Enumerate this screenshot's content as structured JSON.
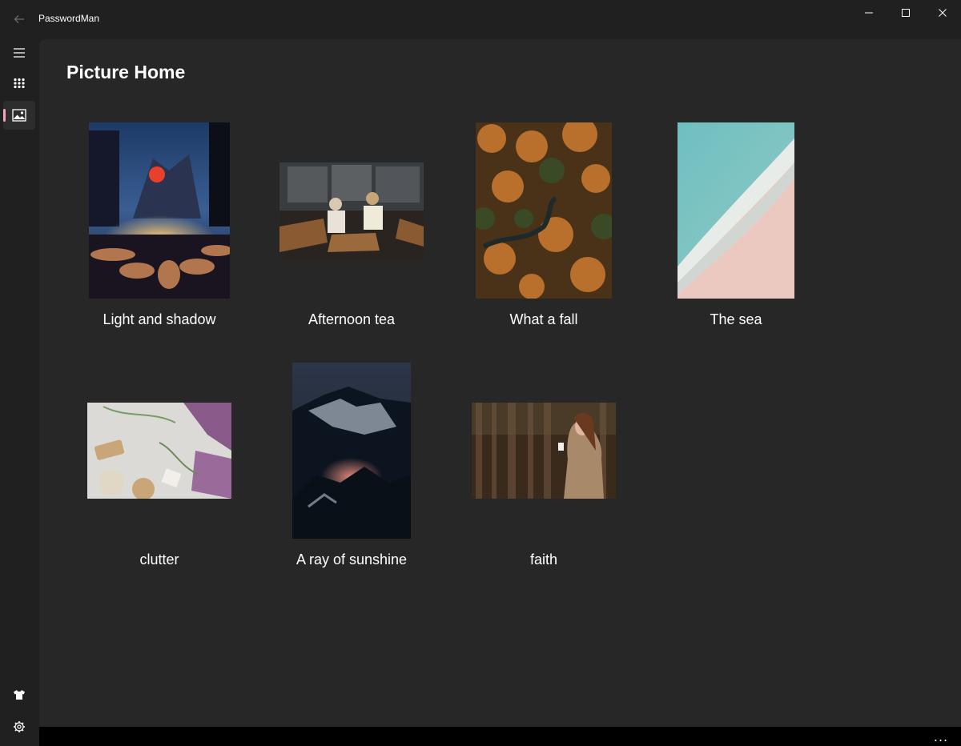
{
  "window": {
    "app_title": "PasswordMan",
    "back_icon": "back-arrow-icon",
    "minimize_icon": "minimize-icon",
    "maximize_icon": "maximize-icon",
    "close_icon": "close-icon"
  },
  "nav": {
    "items": [
      {
        "icon": "hamburger-menu-icon"
      },
      {
        "icon": "keypad-grid-icon"
      },
      {
        "icon": "picture-icon",
        "selected": true
      }
    ],
    "footer_items": [
      {
        "icon": "tshirt-theme-icon"
      },
      {
        "icon": "gear-icon"
      }
    ],
    "indicator_color": "#f4a6b8"
  },
  "page": {
    "title": "Picture Home"
  },
  "gallery": [
    {
      "caption": "Light and shadow"
    },
    {
      "caption": "Afternoon tea"
    },
    {
      "caption": "What a fall"
    },
    {
      "caption": "The sea"
    },
    {
      "caption": "clutter"
    },
    {
      "caption": "A ray of sunshine"
    },
    {
      "caption": "faith"
    }
  ],
  "command_bar": {
    "more_label": "..."
  }
}
